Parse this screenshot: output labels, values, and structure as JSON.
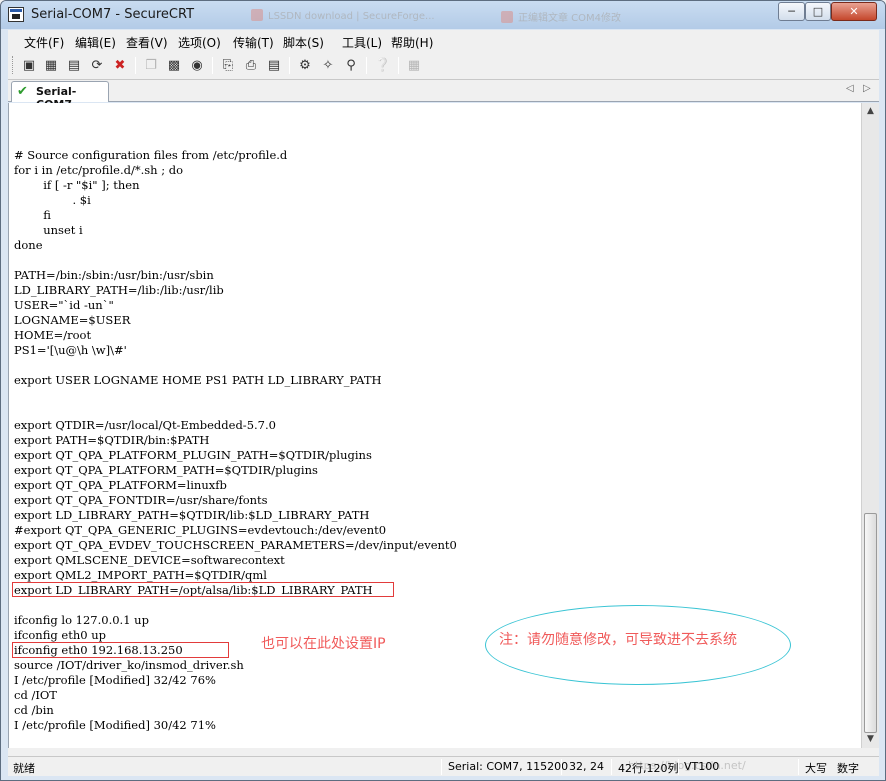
{
  "window": {
    "title": "Serial-COM7 - SecureCRT",
    "background_tabs": [
      "LSSDN download | SecureForge...",
      "正编辑文章 COM4修改"
    ]
  },
  "menu": [
    "文件(F)",
    "编辑(E)",
    "查看(V)",
    "选项(O)",
    "传输(T)",
    "脚本(S)",
    "工具(L)",
    "帮助(H)"
  ],
  "toolbar": {
    "icons": [
      "connect-icon",
      "quick-connect-icon",
      "connect-tab-icon",
      "reconnect-icon",
      "disconnect-icon",
      "copy-icon",
      "paste-icon",
      "find-icon",
      "print-icon",
      "print-setup-icon",
      "print-screen-icon",
      "session-options-icon",
      "global-options-icon",
      "keymap-icon",
      "help-icon",
      "about-icon"
    ]
  },
  "tab": {
    "label": "Serial-COM7"
  },
  "terminal": {
    "lines": [
      "# Source configuration files from /etc/profile.d",
      "for i in /etc/profile.d/*.sh ; do",
      "        if [ -r \"$i\" ]; then",
      "                . $i",
      "        fi",
      "        unset i",
      "done",
      "",
      "PATH=/bin:/sbin:/usr/bin:/usr/sbin",
      "LD_LIBRARY_PATH=/lib:/lib:/usr/lib",
      "USER=\"`id -un`\"",
      "LOGNAME=$USER",
      "HOME=/root",
      "PS1='[\\u@\\h \\w]\\#'",
      "",
      "export USER LOGNAME HOME PS1 PATH LD_LIBRARY_PATH",
      "",
      "",
      "export QTDIR=/usr/local/Qt-Embedded-5.7.0",
      "export PATH=$QTDIR/bin:$PATH",
      "export QT_QPA_PLATFORM_PLUGIN_PATH=$QTDIR/plugins",
      "export QT_QPA_PLATFORM_PATH=$QTDIR/plugins",
      "export QT_QPA_PLATFORM=linuxfb",
      "export QT_QPA_FONTDIR=/usr/share/fonts",
      "export LD_LIBRARY_PATH=$QTDIR/lib:$LD_LIBRARY_PATH",
      "#export QT_QPA_GENERIC_PLUGINS=evdevtouch:/dev/event0",
      "export QT_QPA_EVDEV_TOUCHSCREEN_PARAMETERS=/dev/input/event0",
      "export QMLSCENE_DEVICE=softwarecontext",
      "export QML2_IMPORT_PATH=$QTDIR/qml",
      "export LD_LIBRARY_PATH=/opt/alsa/lib:$LD_LIBRARY_PATH",
      "",
      "ifconfig lo 127.0.0.1 up",
      "ifconfig eth0 up",
      "ifconfig eth0 192.168.13.250",
      "source /IOT/driver_ko/insmod_driver.sh",
      "I /etc/profile [Modified] 32/42 76%",
      "cd /IOT",
      "cd /bin",
      "I /etc/profile [Modified] 30/42 71%"
    ]
  },
  "annotations": {
    "ip_note": "也可以在此处设置IP",
    "warning_note": "注：请勿随意修改，可导致进不去系统"
  },
  "status": {
    "ready": "就绪",
    "port": "Serial: COM7, 115200",
    "cursor": "32,  24",
    "size": "42行,120列",
    "emulation": "VT100",
    "caps": "大写",
    "num": "数字",
    "watermark": "https://blog.csdn.net/"
  }
}
